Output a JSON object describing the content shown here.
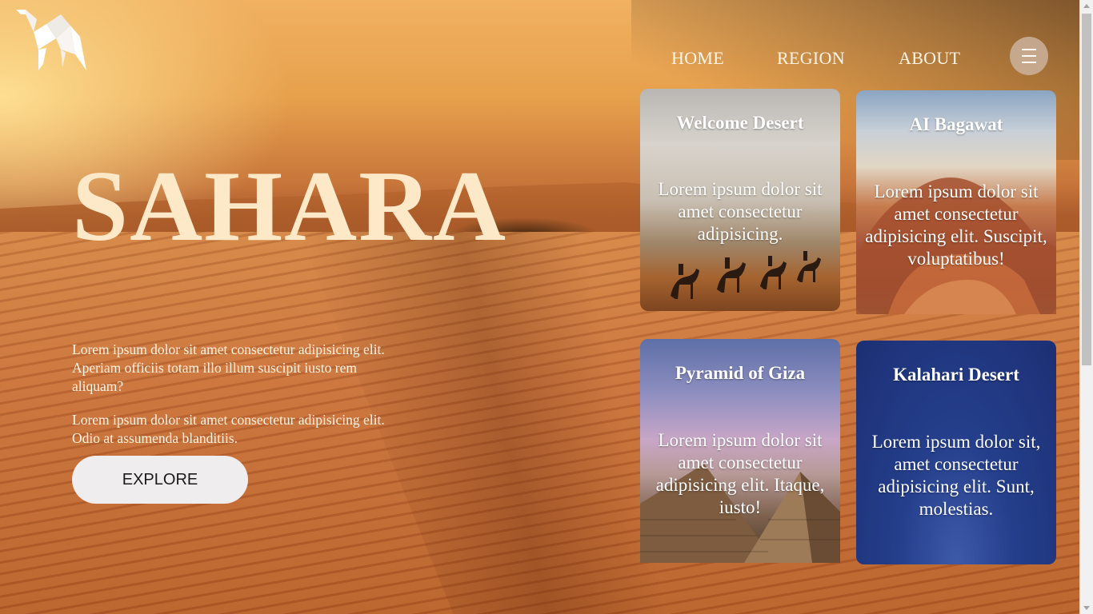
{
  "nav": {
    "items": [
      {
        "label": "HOME"
      },
      {
        "label": "REGION"
      },
      {
        "label": "ABOUT"
      }
    ],
    "menu_icon": "hamburger-icon"
  },
  "logo": {
    "icon": "origami-camel-logo"
  },
  "hero": {
    "title": "SAHARA",
    "paragraph_1": "Lorem ipsum dolor sit amet consectetur adipisicing elit. Aperiam officiis totam illo illum suscipit iusto rem aliquam?",
    "paragraph_2": "Lorem ipsum dolor sit amet consectetur adipisicing elit. Odio at assumenda blanditiis.",
    "button_label": "EXPLORE"
  },
  "cards": [
    {
      "title": "Welcome Desert",
      "text": "Lorem ipsum dolor sit amet consectetur adipisicing."
    },
    {
      "title": "AI Bagawat",
      "text": "Lorem ipsum dolor sit amet consectetur adipisicing elit. Suscipit, voluptatibus!"
    },
    {
      "title": "Pyramid of Giza",
      "text": "Lorem ipsum dolor sit amet consectetur adipisicing elit. Itaque, iusto!"
    },
    {
      "title": "Kalahari Desert",
      "text": "Lorem ipsum dolor sit, amet consectetur adipisicing elit. Sunt, molestias."
    }
  ],
  "colors": {
    "title": "#fde8c8",
    "button_bg": "#efeded",
    "menu_bg": "#d2beaf"
  }
}
